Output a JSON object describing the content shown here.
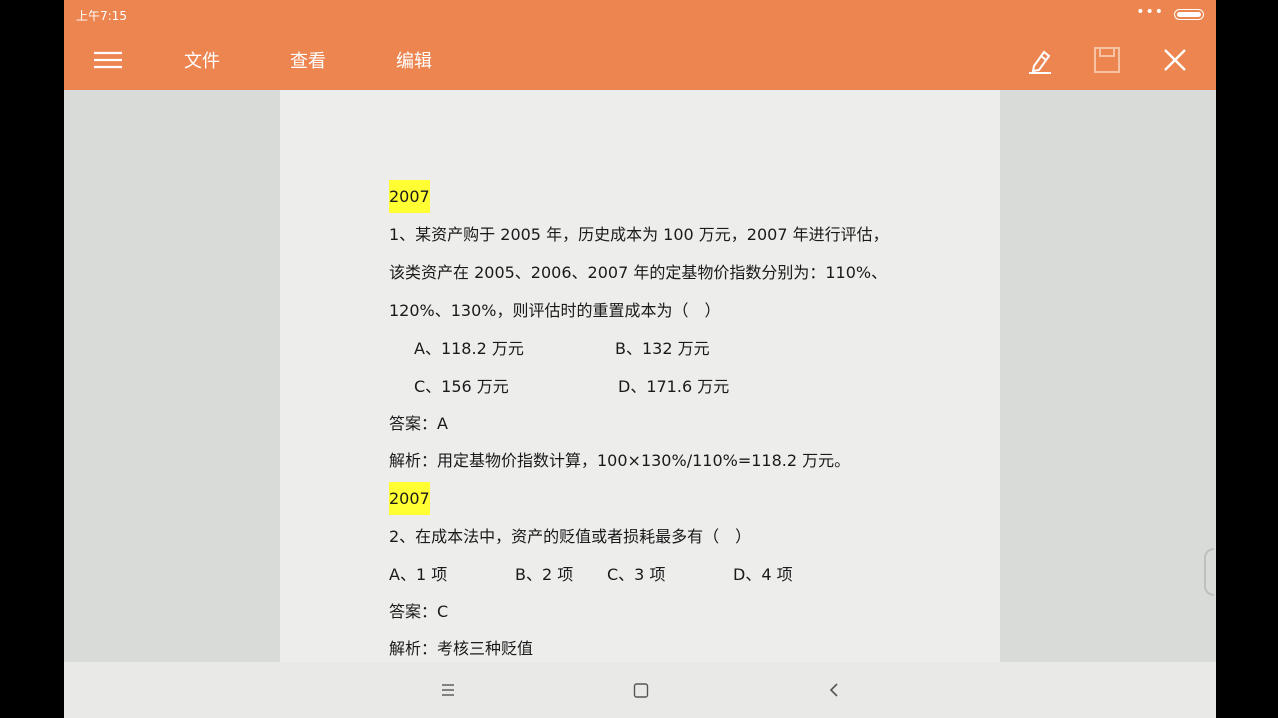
{
  "status_bar": {
    "time": "上午7:15",
    "dots": "•••"
  },
  "toolbar": {
    "menu_items": [
      "文件",
      "查看",
      "编辑"
    ]
  },
  "document": {
    "blocks": [
      {
        "year": "2007"
      },
      {
        "q1_line1": "1、某资产购于 2005 年，历史成本为 100 万元，2007 年进行评估，"
      },
      {
        "q1_line2": "该类资产在 2005、2006、2007 年的定基物价指数分别为：110%、"
      },
      {
        "q1_line3": "120%、130%，则评估时的重置成本为（　）"
      }
    ],
    "q1": {
      "year": "2007",
      "line1": "1、某资产购于 2005 年，历史成本为 100 万元，2007 年进行评估，",
      "line2": "该类资产在 2005、2006、2007 年的定基物价指数分别为：110%、",
      "line3": "120%、130%，则评估时的重置成本为（　）",
      "option_a": "A、118.2 万元",
      "option_b": "B、132 万元",
      "option_c": "C、156 万元",
      "option_d": "D、171.6 万元",
      "answer": "答案：A",
      "analysis": "解析：用定基物价指数计算，100×130%/110%=118.2 万元。"
    },
    "q2": {
      "year": "2007",
      "line1": "2、在成本法中，资产的贬值或者损耗最多有（　）",
      "option_a": "A、1 项",
      "option_b": "B、2 项",
      "option_c": "C、3 项",
      "option_d": "D、4 项",
      "answer": "答案：C",
      "analysis": "解析：考核三种贬值"
    }
  },
  "colors": {
    "accent": "#ec8550",
    "highlight": "#ffff33"
  }
}
